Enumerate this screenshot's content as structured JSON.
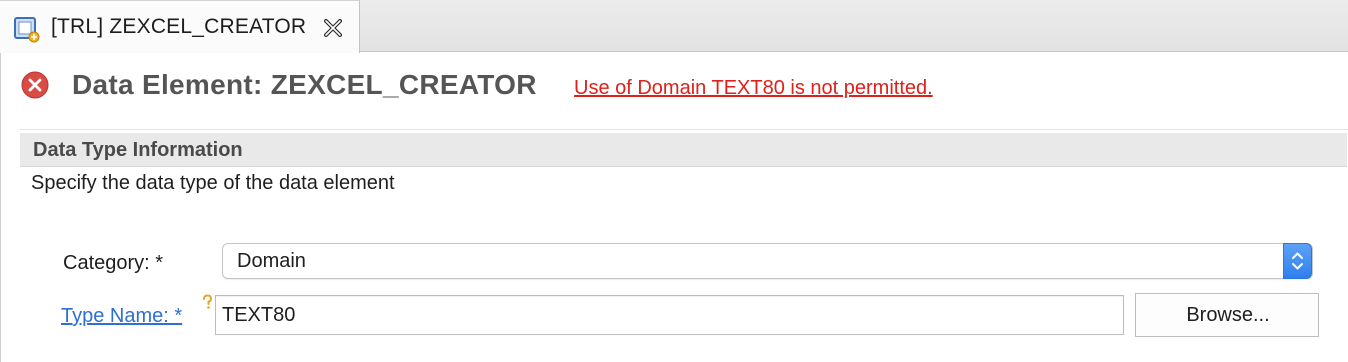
{
  "tab": {
    "label": "[TRL] ZEXCEL_CREATOR",
    "icon": "data-element-icon",
    "close_icon": "close-icon"
  },
  "header": {
    "title": "Data Element: ZEXCEL_CREATOR",
    "error_message": "Use of Domain TEXT80 is not permitted.",
    "status_icon": "error-icon",
    "error_color": "#e0201a"
  },
  "section": {
    "title": "Data Type Information",
    "description": "Specify the data type of the data element"
  },
  "form": {
    "category_label": "Category: *",
    "category_value": "Domain",
    "type_name_label": "Type Name: *",
    "type_name_value": "TEXT80",
    "browse_label": "Browse..."
  },
  "colors": {
    "link": "#2d6fd2",
    "select_accent": "#2f7ff0"
  }
}
